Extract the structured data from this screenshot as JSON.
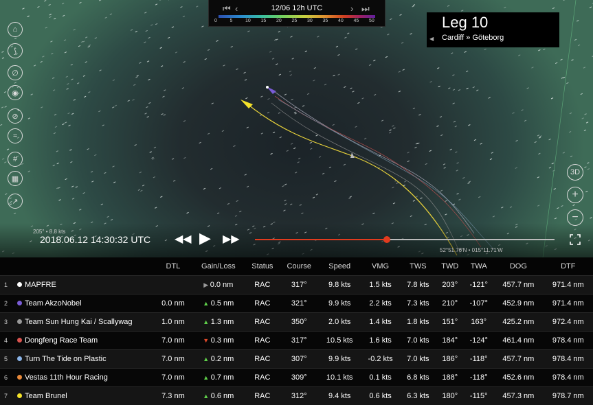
{
  "timeline": {
    "date_label": "12/06 12h UTC",
    "wind_scale": [
      "0",
      "5",
      "10",
      "15",
      "20",
      "25",
      "30",
      "35",
      "40",
      "45",
      "50"
    ]
  },
  "leg": {
    "title": "Leg 10",
    "route": "Cardiff » Göteborg"
  },
  "playback": {
    "timestamp": "2018.06.12 14:30:32 UTC",
    "boat_info": "205° • 8.8 kts",
    "coordinates": "52°51.76'N • 015°11.71'W",
    "progress": 0.44
  },
  "left_tools": [
    "map-book-icon",
    "route-icon",
    "compass-icon",
    "camera-icon",
    "wind-icon",
    "current-icon",
    "grid-icon",
    "layers-icon",
    "chart-icon"
  ],
  "right_tools": {
    "view_3d": "3D"
  },
  "table": {
    "headers": [
      "DTL",
      "Gain/Loss",
      "Status",
      "Course",
      "Speed",
      "VMG",
      "TWS",
      "TWD",
      "TWA",
      "DOG",
      "DTF"
    ],
    "rows": [
      {
        "rank": "1",
        "color": "#ffffff",
        "name": "MAPFRE",
        "dtl": "",
        "gain_dir": "eq",
        "gain": "0.0 nm",
        "status": "RAC",
        "course": "317°",
        "speed": "9.8 kts",
        "vmg": "1.5 kts",
        "tws": "7.8 kts",
        "twd": "203°",
        "twa": "-121°",
        "dog": "457.7 nm",
        "dtf": "971.4 nm"
      },
      {
        "rank": "2",
        "color": "#7a5cd6",
        "name": "Team AkzoNobel",
        "dtl": "0.0 nm",
        "gain_dir": "up",
        "gain": "0.5 nm",
        "status": "RAC",
        "course": "321°",
        "speed": "9.9 kts",
        "vmg": "2.2 kts",
        "tws": "7.3 kts",
        "twd": "210°",
        "twa": "-107°",
        "dog": "452.9 nm",
        "dtf": "971.4 nm"
      },
      {
        "rank": "3",
        "color": "#999999",
        "name": "Team Sun Hung Kai / Scallywag",
        "dtl": "1.0 nm",
        "gain_dir": "up",
        "gain": "1.3 nm",
        "status": "RAC",
        "course": "350°",
        "speed": "2.0 kts",
        "vmg": "1.4 kts",
        "tws": "1.8 kts",
        "twd": "151°",
        "twa": "163°",
        "dog": "425.2 nm",
        "dtf": "972.4 nm"
      },
      {
        "rank": "4",
        "color": "#d9534f",
        "name": "Dongfeng Race Team",
        "dtl": "7.0 nm",
        "gain_dir": "down",
        "gain": "0.3 nm",
        "status": "RAC",
        "course": "317°",
        "speed": "10.5 kts",
        "vmg": "1.6 kts",
        "tws": "7.0 kts",
        "twd": "184°",
        "twa": "-124°",
        "dog": "461.4 nm",
        "dtf": "978.4 nm"
      },
      {
        "rank": "5",
        "color": "#8ab4e8",
        "name": "Turn The Tide on Plastic",
        "dtl": "7.0 nm",
        "gain_dir": "up",
        "gain": "0.2 nm",
        "status": "RAC",
        "course": "307°",
        "speed": "9.9 kts",
        "vmg": "-0.2 kts",
        "tws": "7.0 kts",
        "twd": "186°",
        "twa": "-118°",
        "dog": "457.7 nm",
        "dtf": "978.4 nm"
      },
      {
        "rank": "6",
        "color": "#e8893a",
        "name": "Vestas 11th Hour Racing",
        "dtl": "7.0 nm",
        "gain_dir": "up",
        "gain": "0.7 nm",
        "status": "RAC",
        "course": "309°",
        "speed": "10.1 kts",
        "vmg": "0.1 kts",
        "tws": "6.8 kts",
        "twd": "188°",
        "twa": "-118°",
        "dog": "452.6 nm",
        "dtf": "978.4 nm"
      },
      {
        "rank": "7",
        "color": "#f5e32a",
        "name": "Team Brunel",
        "dtl": "7.3 nm",
        "gain_dir": "up",
        "gain": "0.6 nm",
        "status": "RAC",
        "course": "312°",
        "speed": "9.4 kts",
        "vmg": "0.6 kts",
        "tws": "6.3 kts",
        "twd": "180°",
        "twa": "-115°",
        "dog": "457.3 nm",
        "dtf": "978.7 nm"
      }
    ]
  }
}
